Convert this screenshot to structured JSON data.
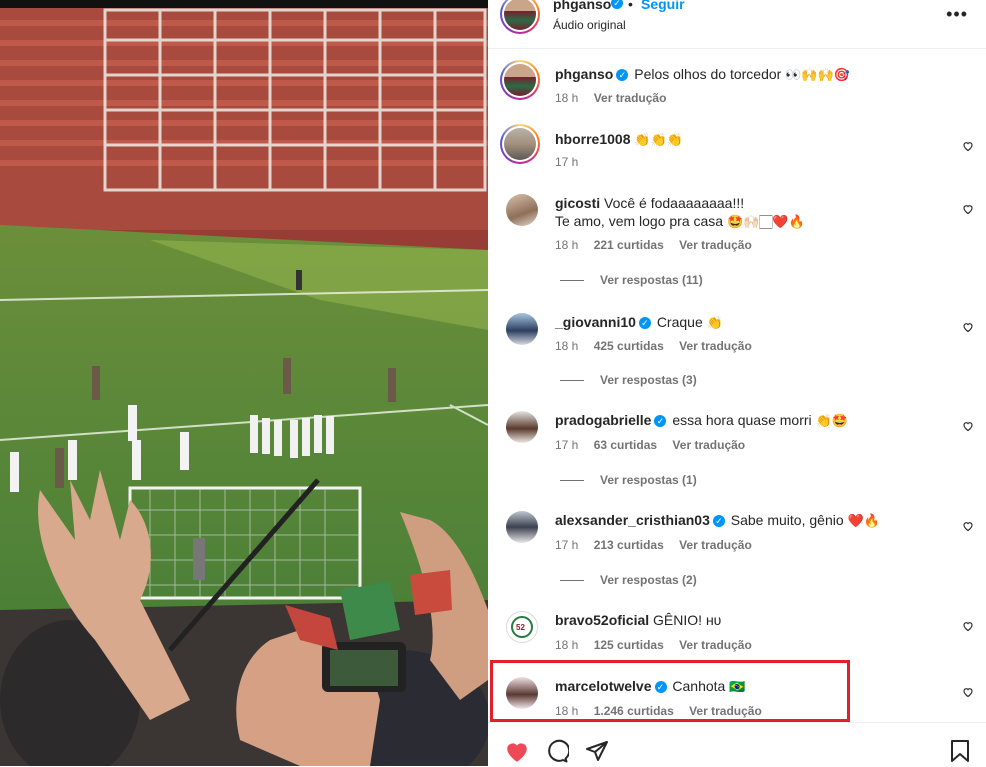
{
  "post": {
    "username": "phganso",
    "follow_label": "Seguir",
    "audio": "Áudio original",
    "more_icon": "more-horizontal-icon"
  },
  "caption": {
    "username": "phganso",
    "text": "Pelos olhos do torcedor",
    "emojis": "👀🙌🙌🎯",
    "time": "18 h",
    "translate": "Ver tradução"
  },
  "comments": [
    {
      "username": "hborre1008",
      "verified": false,
      "text": "",
      "emojis": "👏👏👏",
      "time": "17 h",
      "likes": "",
      "translate": "",
      "replies": ""
    },
    {
      "username": "gicosti",
      "verified": false,
      "text": "Você é fodaaaaaaaa!!!",
      "text2": "Te amo, vem logo pra casa",
      "emojis": "🤩🙌🏻🏻❤️🔥",
      "time": "18 h",
      "likes": "221 curtidas",
      "translate": "Ver tradução",
      "replies": "Ver respostas (11)"
    },
    {
      "username": "_giovanni10",
      "verified": true,
      "text": "Craque",
      "emojis": "👏",
      "time": "18 h",
      "likes": "425 curtidas",
      "translate": "Ver tradução",
      "replies": "Ver respostas (3)"
    },
    {
      "username": "pradogabrielle",
      "verified": true,
      "text": "essa hora quase morri",
      "emojis": "👏🤩",
      "time": "17 h",
      "likes": "63 curtidas",
      "translate": "Ver tradução",
      "replies": "Ver respostas (1)"
    },
    {
      "username": "alexsander_cristhian03",
      "verified": true,
      "text": "Sabe muito, gênio",
      "emojis": "❤️🔥",
      "time": "17 h",
      "likes": "213 curtidas",
      "translate": "Ver tradução",
      "replies": "Ver respostas (2)"
    },
    {
      "username": "bravo52oficial",
      "verified": false,
      "text": "GÊNIO! ʜᴜ",
      "emojis": "",
      "time": "18 h",
      "likes": "125 curtidas",
      "translate": "Ver tradução",
      "replies": ""
    },
    {
      "username": "marcelotwelve",
      "verified": true,
      "text": "Canhota",
      "emojis": "🇧🇷",
      "time": "18 h",
      "likes": "1.246 curtidas",
      "translate": "Ver tradução",
      "replies": ""
    }
  ],
  "colors": {
    "accent": "#0095f6",
    "like": "#ed4956",
    "highlight": "#e0202a"
  },
  "actions": {
    "like_icon": "heart-filled-icon",
    "comment_icon": "comment-icon",
    "share_icon": "share-icon",
    "save_icon": "bookmark-icon"
  }
}
